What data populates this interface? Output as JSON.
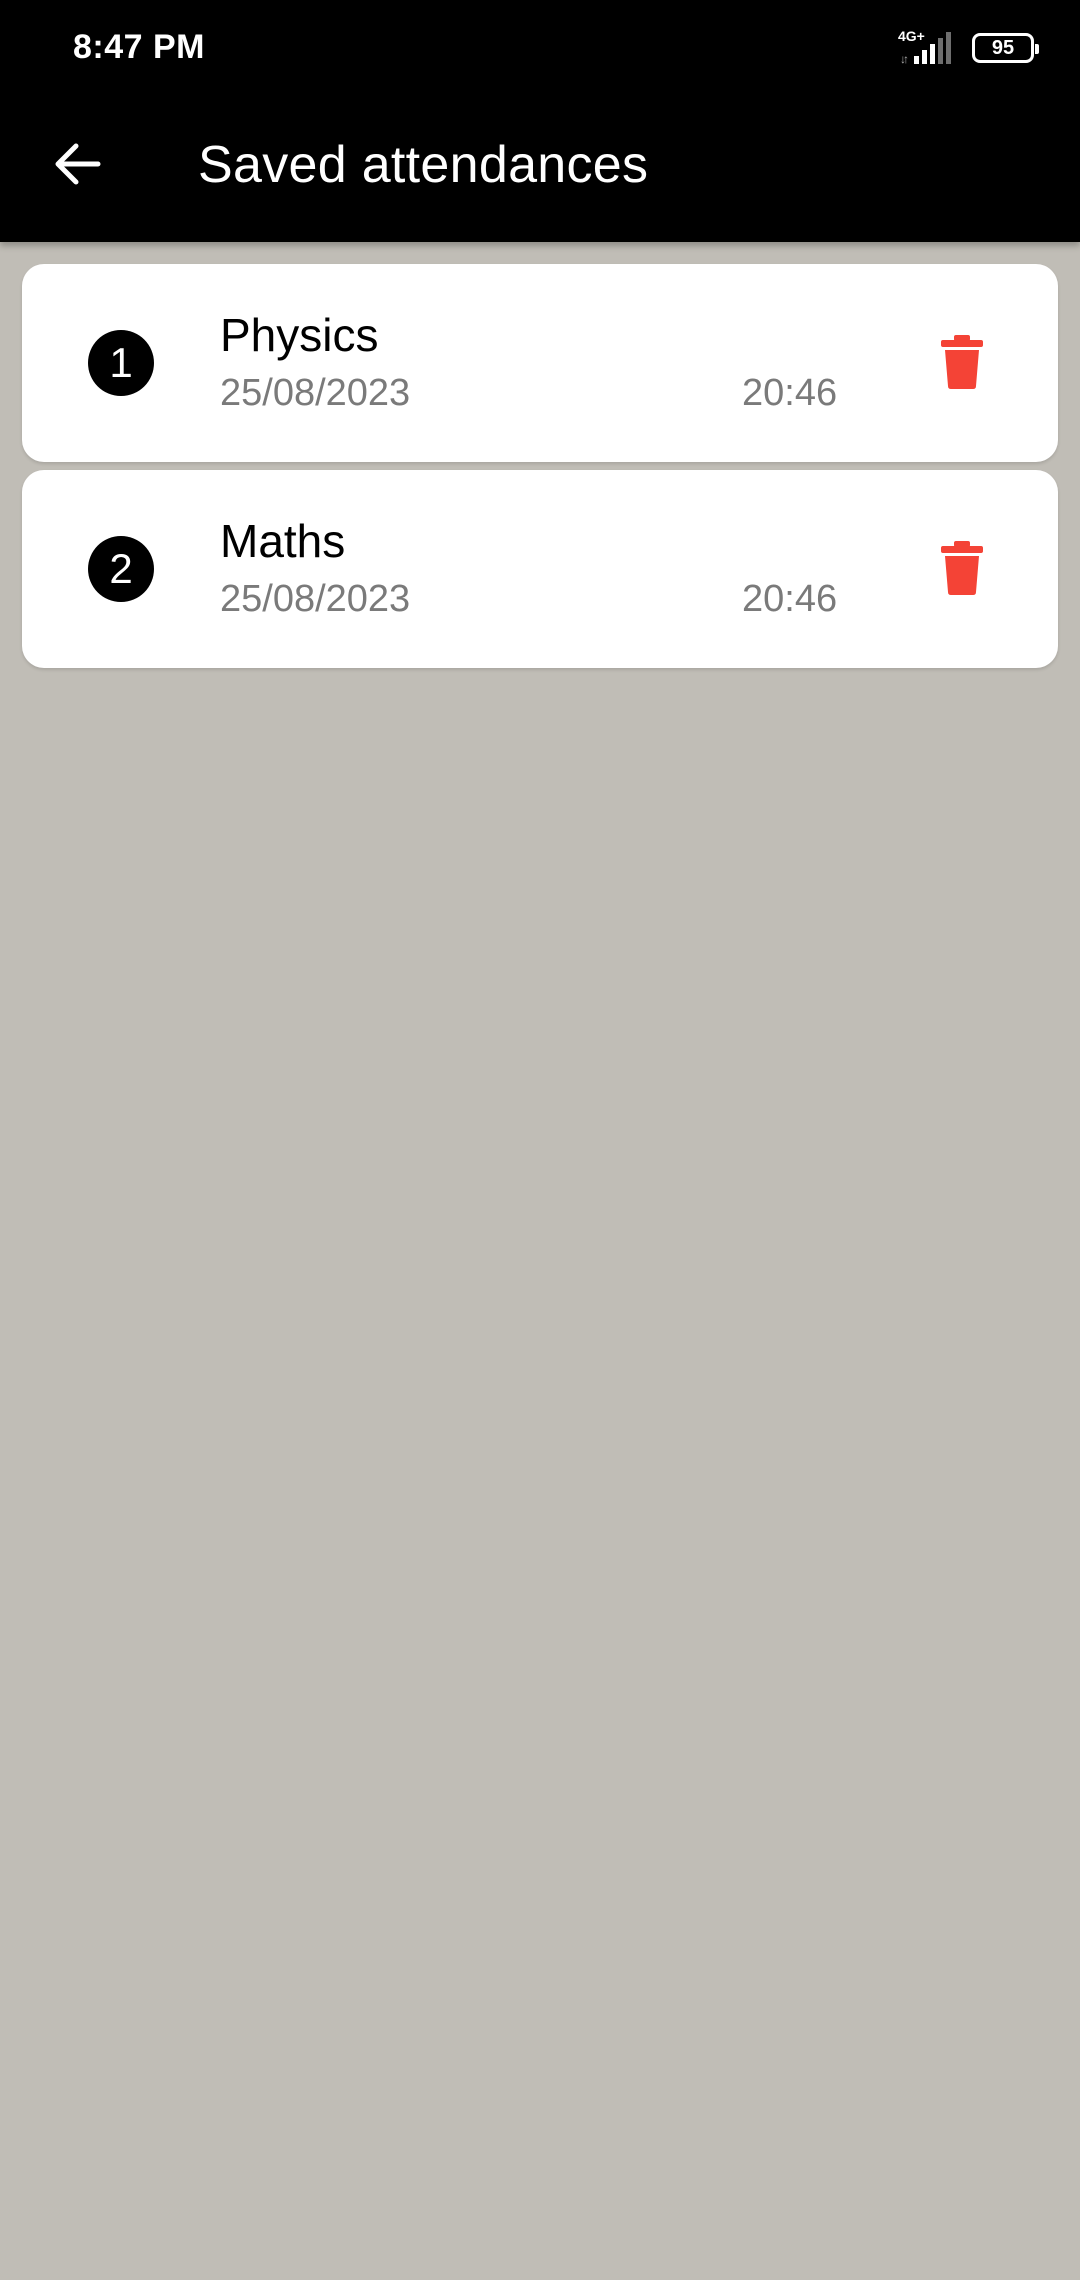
{
  "status_bar": {
    "time": "8:47 PM",
    "network_type": "4G+",
    "network_arrows": "↓↑",
    "battery_level": "95",
    "icons": [
      "signal-icon",
      "battery-icon"
    ]
  },
  "app_bar": {
    "title": "Saved attendances",
    "back_icon": "arrow-left-icon"
  },
  "colors": {
    "app_bar_background": "#000000",
    "page_background": "#c0bdb6",
    "card_background": "#ffffff",
    "delete_icon": "#f44336",
    "secondary_text": "#7a7a7a"
  },
  "records": [
    {
      "index": "1",
      "subject": "Physics",
      "date": "25/08/2023",
      "time": "20:46",
      "action_icon": "trash-icon"
    },
    {
      "index": "2",
      "subject": "Maths",
      "date": "25/08/2023",
      "time": "20:46",
      "action_icon": "trash-icon"
    }
  ]
}
